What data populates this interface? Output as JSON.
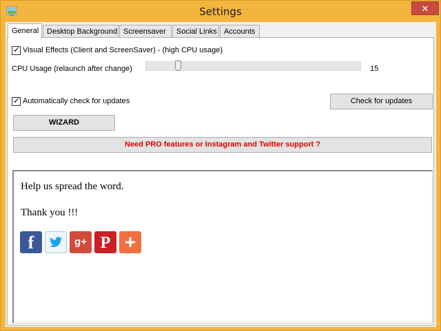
{
  "window": {
    "title": "Settings",
    "close_glyph": "✕"
  },
  "tabs": [
    {
      "label": "General",
      "active": true
    },
    {
      "label": "Desktop Background",
      "active": false
    },
    {
      "label": "Screensaver",
      "active": false
    },
    {
      "label": "Social Links",
      "active": false
    },
    {
      "label": "Accounts",
      "active": false
    }
  ],
  "general": {
    "visual_effects": {
      "label": "Visual Effects (Client and ScreenSaver) - (high CPU usage)",
      "checked": true
    },
    "cpu_usage": {
      "label": "CPU Usage (relaunch after change)",
      "value": "15",
      "level": 15,
      "max": 100
    },
    "auto_update": {
      "label": "Automatically check for updates",
      "checked": true
    },
    "check_updates_button": "Check for updates",
    "wizard_button": "WIZARD",
    "pro_button": "Need PRO features or Instagram and Twitter support ?",
    "pro_color": "#e00000"
  },
  "share": {
    "line1": "Help us spread the word.",
    "line2": "Thank you !!!",
    "icons": [
      {
        "name": "facebook-icon",
        "glyph": "f",
        "color": "#3b5998"
      },
      {
        "name": "twitter-icon",
        "glyph": "bird",
        "color": "#1da1f2"
      },
      {
        "name": "google-plus-icon",
        "glyph": "g+",
        "color": "#d24a3a"
      },
      {
        "name": "pinterest-icon",
        "glyph": "P",
        "color": "#cb2027"
      },
      {
        "name": "add-more-icon",
        "glyph": "+",
        "color": "#f26f3f"
      }
    ]
  }
}
